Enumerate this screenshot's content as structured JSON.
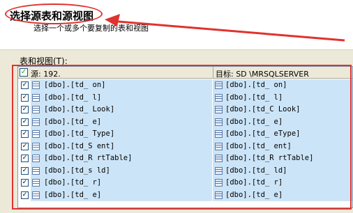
{
  "header": {
    "title": "选择源表和源视图",
    "subtitle": "选择一个或多个要复制的表和视图"
  },
  "list_label": "表和视图(T):",
  "grid": {
    "columns": {
      "source": "源: 192.",
      "destination": "目标: SD                \\MRSQLSERVER",
      "header_checked": "✓"
    },
    "rows": [
      {
        "checked": "✓",
        "source": "[dbo].[td_       on]",
        "destination": "[dbo].[td_       on]"
      },
      {
        "checked": "✓",
        "source": "[dbo].[td_    l]",
        "destination": "[dbo].[td_    l]"
      },
      {
        "checked": "✓",
        "source": "[dbo].[td_   Look]",
        "destination": "[dbo].[td_C   Look]"
      },
      {
        "checked": "✓",
        "source": "[dbo].[td_    e]",
        "destination": "[dbo].[td_    e]"
      },
      {
        "checked": "✓",
        "source": "[dbo].[td_    Type]",
        "destination": "[dbo].[td_    eType]"
      },
      {
        "checked": "✓",
        "source": "[dbo].[td_S     ent]",
        "destination": "[dbo].[td_     ent]"
      },
      {
        "checked": "✓",
        "source": "[dbo].[td_R    rtTable]",
        "destination": "[dbo].[td_R    rtTable]"
      },
      {
        "checked": "✓",
        "source": "[dbo].[td_s     ld]",
        "destination": "[dbo].[td_     ld]"
      },
      {
        "checked": "✓",
        "source": "[dbo].[td_    r]",
        "destination": "[dbo].[td_    r]"
      },
      {
        "checked": "✓",
        "source": "[dbo].[td_   e]",
        "destination": "[dbo].[td_   e]"
      }
    ]
  },
  "annotation_color": "#e0322e",
  "icons": {
    "row_checkbox": "checkbox-checked-icon",
    "source_table": "table-icon",
    "destination_table": "table-icon"
  }
}
